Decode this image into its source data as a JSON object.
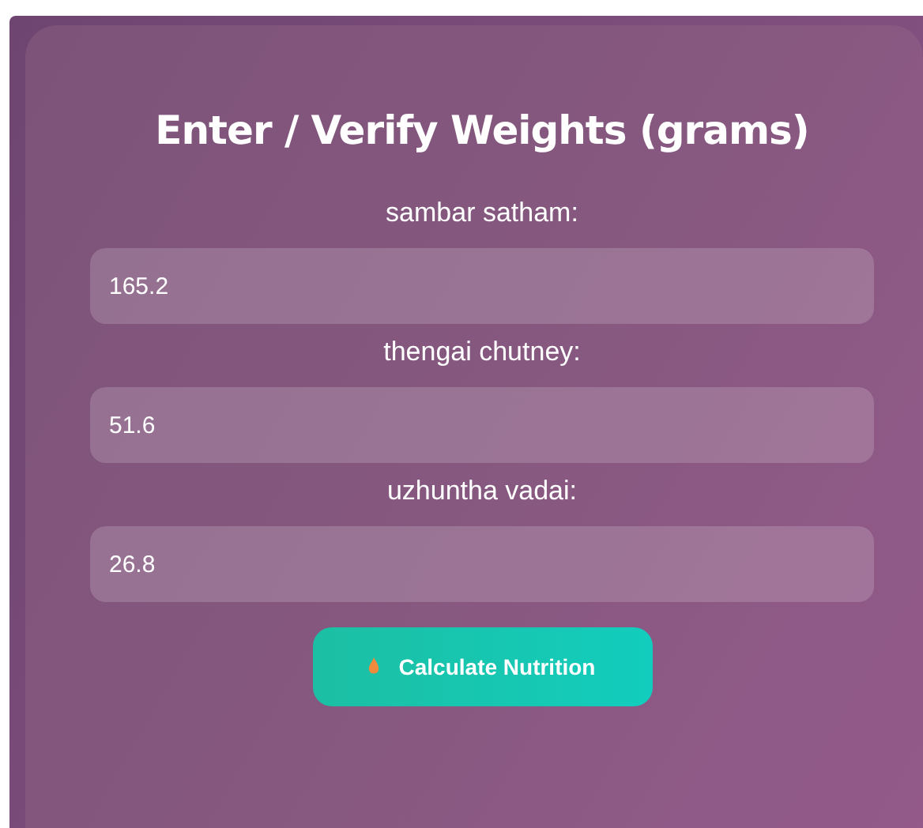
{
  "title": "Enter / Verify Weights (grams)",
  "fields": [
    {
      "label": "sambar satham:",
      "value": "165.2"
    },
    {
      "label": "thengai chutney:",
      "value": "51.6"
    },
    {
      "label": "uzhuntha vadai:",
      "value": "26.8"
    }
  ],
  "button": {
    "label": "Calculate Nutrition"
  }
}
